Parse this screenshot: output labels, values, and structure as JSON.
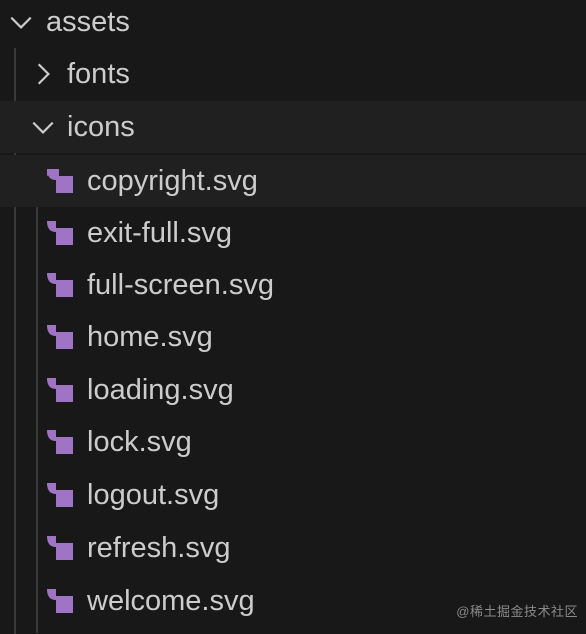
{
  "explorer": {
    "root_folder": {
      "label": "assets",
      "expanded": true
    },
    "folders": [
      {
        "label": "fonts",
        "expanded": false
      },
      {
        "label": "icons",
        "expanded": true
      }
    ],
    "files": [
      {
        "label": "copyright.svg",
        "icon": "svg-file-icon"
      },
      {
        "label": "exit-full.svg",
        "icon": "svg-file-icon"
      },
      {
        "label": "full-screen.svg",
        "icon": "svg-file-icon"
      },
      {
        "label": "home.svg",
        "icon": "svg-file-icon"
      },
      {
        "label": "loading.svg",
        "icon": "svg-file-icon"
      },
      {
        "label": "lock.svg",
        "icon": "svg-file-icon"
      },
      {
        "label": "logout.svg",
        "icon": "svg-file-icon"
      },
      {
        "label": "refresh.svg",
        "icon": "svg-file-icon"
      },
      {
        "label": "welcome.svg",
        "icon": "svg-file-icon"
      }
    ]
  },
  "colors": {
    "background": "#181818",
    "text": "#cccccc",
    "svg_icon": "#a074c4",
    "guide_line": "#3a3a3a"
  },
  "watermark": "@稀土掘金技术社区"
}
